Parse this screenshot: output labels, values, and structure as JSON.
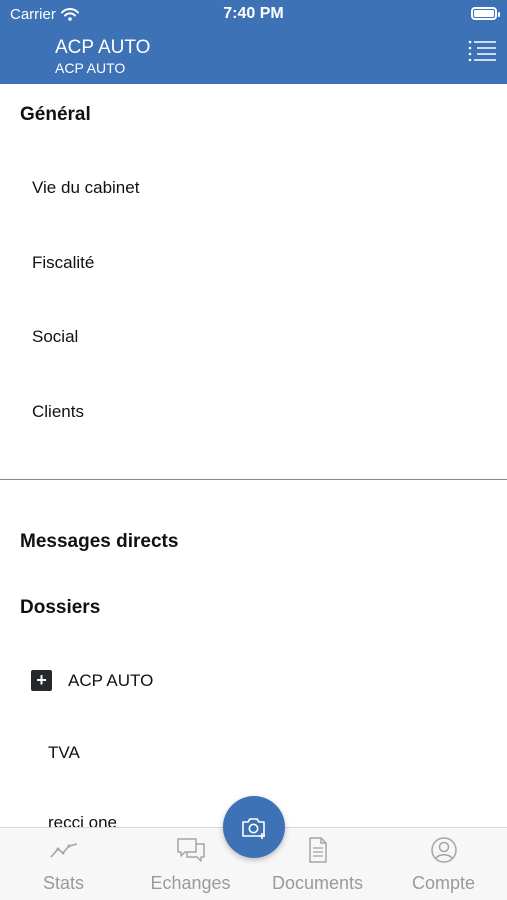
{
  "status_bar": {
    "carrier": "Carrier",
    "time": "7:40 PM"
  },
  "header": {
    "title": "ACP AUTO",
    "subtitle": "ACP AUTO",
    "color": "#3d72b6"
  },
  "general": {
    "title": "Général",
    "items": [
      "Vie du cabinet",
      "Fiscalité",
      "Social",
      "Clients"
    ]
  },
  "messages": {
    "title": "Messages directs"
  },
  "dossiers": {
    "title": "Dossiers",
    "folder": {
      "label": "ACP AUTO",
      "icon": "plus-icon"
    },
    "subitems": [
      "TVA",
      "recci one"
    ]
  },
  "tabbar": {
    "tabs": [
      {
        "label": "Stats",
        "icon": "stats-icon"
      },
      {
        "label": "Echanges",
        "icon": "chat-icon"
      },
      {
        "label": "Documents",
        "icon": "document-icon"
      },
      {
        "label": "Compte",
        "icon": "account-icon"
      }
    ],
    "fab_icon": "camera-add-icon"
  }
}
